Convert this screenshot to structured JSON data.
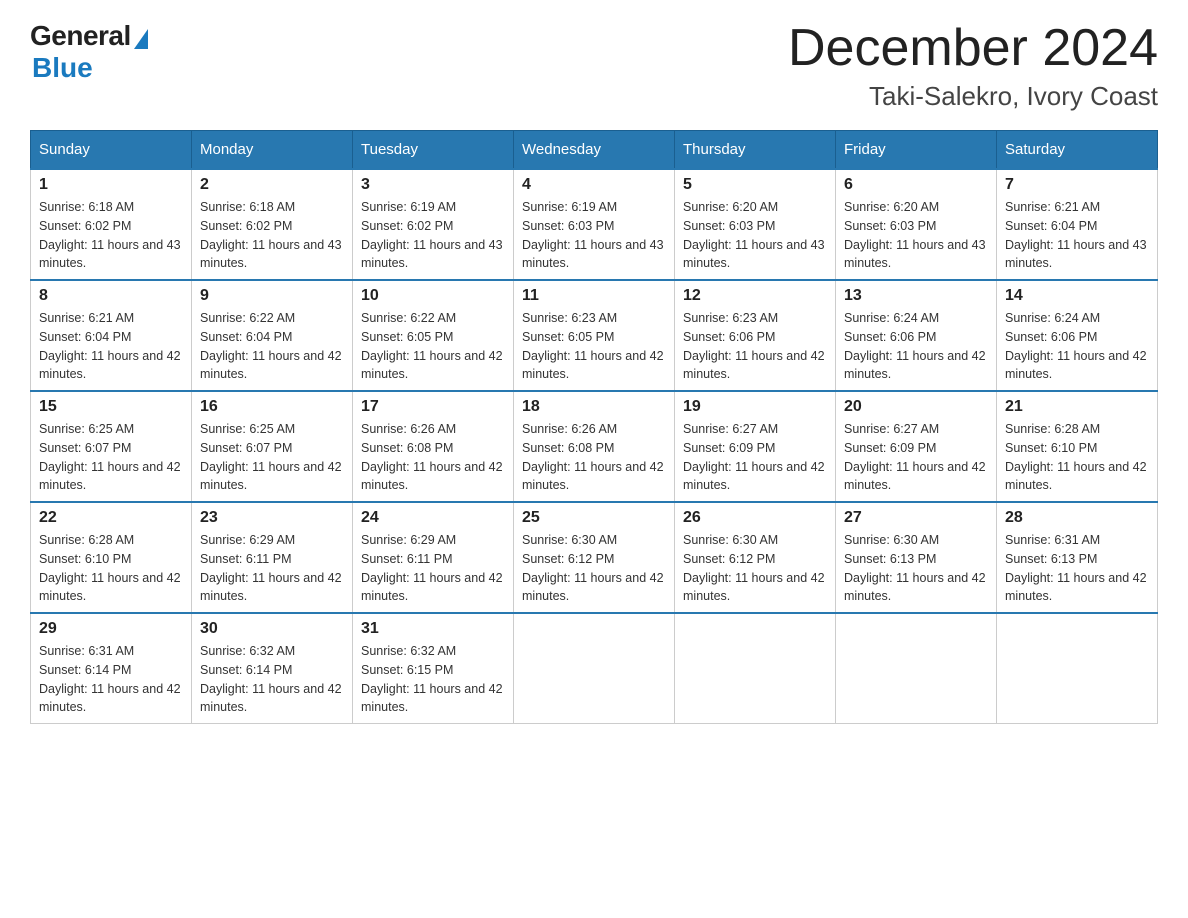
{
  "header": {
    "logo_general": "General",
    "logo_blue": "Blue",
    "month_title": "December 2024",
    "location": "Taki-Salekro, Ivory Coast"
  },
  "days_of_week": [
    "Sunday",
    "Monday",
    "Tuesday",
    "Wednesday",
    "Thursday",
    "Friday",
    "Saturday"
  ],
  "weeks": [
    [
      {
        "day": "1",
        "sunrise": "6:18 AM",
        "sunset": "6:02 PM",
        "daylight": "11 hours and 43 minutes."
      },
      {
        "day": "2",
        "sunrise": "6:18 AM",
        "sunset": "6:02 PM",
        "daylight": "11 hours and 43 minutes."
      },
      {
        "day": "3",
        "sunrise": "6:19 AM",
        "sunset": "6:02 PM",
        "daylight": "11 hours and 43 minutes."
      },
      {
        "day": "4",
        "sunrise": "6:19 AM",
        "sunset": "6:03 PM",
        "daylight": "11 hours and 43 minutes."
      },
      {
        "day": "5",
        "sunrise": "6:20 AM",
        "sunset": "6:03 PM",
        "daylight": "11 hours and 43 minutes."
      },
      {
        "day": "6",
        "sunrise": "6:20 AM",
        "sunset": "6:03 PM",
        "daylight": "11 hours and 43 minutes."
      },
      {
        "day": "7",
        "sunrise": "6:21 AM",
        "sunset": "6:04 PM",
        "daylight": "11 hours and 43 minutes."
      }
    ],
    [
      {
        "day": "8",
        "sunrise": "6:21 AM",
        "sunset": "6:04 PM",
        "daylight": "11 hours and 42 minutes."
      },
      {
        "day": "9",
        "sunrise": "6:22 AM",
        "sunset": "6:04 PM",
        "daylight": "11 hours and 42 minutes."
      },
      {
        "day": "10",
        "sunrise": "6:22 AM",
        "sunset": "6:05 PM",
        "daylight": "11 hours and 42 minutes."
      },
      {
        "day": "11",
        "sunrise": "6:23 AM",
        "sunset": "6:05 PM",
        "daylight": "11 hours and 42 minutes."
      },
      {
        "day": "12",
        "sunrise": "6:23 AM",
        "sunset": "6:06 PM",
        "daylight": "11 hours and 42 minutes."
      },
      {
        "day": "13",
        "sunrise": "6:24 AM",
        "sunset": "6:06 PM",
        "daylight": "11 hours and 42 minutes."
      },
      {
        "day": "14",
        "sunrise": "6:24 AM",
        "sunset": "6:06 PM",
        "daylight": "11 hours and 42 minutes."
      }
    ],
    [
      {
        "day": "15",
        "sunrise": "6:25 AM",
        "sunset": "6:07 PM",
        "daylight": "11 hours and 42 minutes."
      },
      {
        "day": "16",
        "sunrise": "6:25 AM",
        "sunset": "6:07 PM",
        "daylight": "11 hours and 42 minutes."
      },
      {
        "day": "17",
        "sunrise": "6:26 AM",
        "sunset": "6:08 PM",
        "daylight": "11 hours and 42 minutes."
      },
      {
        "day": "18",
        "sunrise": "6:26 AM",
        "sunset": "6:08 PM",
        "daylight": "11 hours and 42 minutes."
      },
      {
        "day": "19",
        "sunrise": "6:27 AM",
        "sunset": "6:09 PM",
        "daylight": "11 hours and 42 minutes."
      },
      {
        "day": "20",
        "sunrise": "6:27 AM",
        "sunset": "6:09 PM",
        "daylight": "11 hours and 42 minutes."
      },
      {
        "day": "21",
        "sunrise": "6:28 AM",
        "sunset": "6:10 PM",
        "daylight": "11 hours and 42 minutes."
      }
    ],
    [
      {
        "day": "22",
        "sunrise": "6:28 AM",
        "sunset": "6:10 PM",
        "daylight": "11 hours and 42 minutes."
      },
      {
        "day": "23",
        "sunrise": "6:29 AM",
        "sunset": "6:11 PM",
        "daylight": "11 hours and 42 minutes."
      },
      {
        "day": "24",
        "sunrise": "6:29 AM",
        "sunset": "6:11 PM",
        "daylight": "11 hours and 42 minutes."
      },
      {
        "day": "25",
        "sunrise": "6:30 AM",
        "sunset": "6:12 PM",
        "daylight": "11 hours and 42 minutes."
      },
      {
        "day": "26",
        "sunrise": "6:30 AM",
        "sunset": "6:12 PM",
        "daylight": "11 hours and 42 minutes."
      },
      {
        "day": "27",
        "sunrise": "6:30 AM",
        "sunset": "6:13 PM",
        "daylight": "11 hours and 42 minutes."
      },
      {
        "day": "28",
        "sunrise": "6:31 AM",
        "sunset": "6:13 PM",
        "daylight": "11 hours and 42 minutes."
      }
    ],
    [
      {
        "day": "29",
        "sunrise": "6:31 AM",
        "sunset": "6:14 PM",
        "daylight": "11 hours and 42 minutes."
      },
      {
        "day": "30",
        "sunrise": "6:32 AM",
        "sunset": "6:14 PM",
        "daylight": "11 hours and 42 minutes."
      },
      {
        "day": "31",
        "sunrise": "6:32 AM",
        "sunset": "6:15 PM",
        "daylight": "11 hours and 42 minutes."
      },
      null,
      null,
      null,
      null
    ]
  ]
}
